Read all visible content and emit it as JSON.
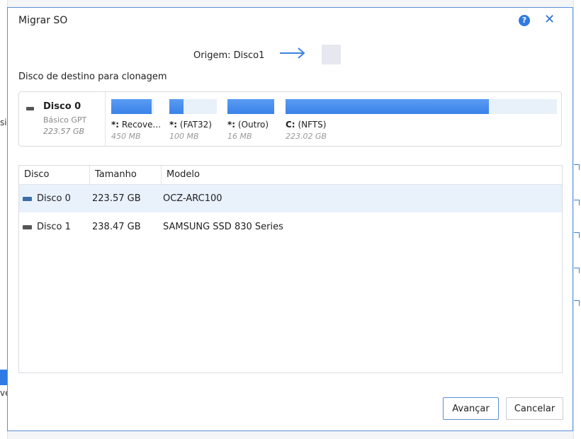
{
  "dialog": {
    "title": "Migrar SO",
    "help_icon": "question-circle-icon",
    "close_icon": "close-icon",
    "origin_label": "Origem: Disco1",
    "dest_label": "Disco de destino para clonagem",
    "accent_color": "#2f7be6"
  },
  "disk_map": {
    "name": "Disco 0",
    "type": "Básico GPT",
    "size": "223.57 GB",
    "partitions": [
      {
        "letter": "*:",
        "label": "Recove...",
        "size": "450 MB",
        "usage": 0.95
      },
      {
        "letter": "*:",
        "label": "(FAT32)",
        "size": "100 MB",
        "usage": 0.3
      },
      {
        "letter": "*:",
        "label": "(Outro)",
        "size": "16 MB",
        "usage": 1.0
      },
      {
        "letter": "C:",
        "label": "(NFTS)",
        "size": "223.02 GB",
        "usage": 0.75
      }
    ]
  },
  "table": {
    "columns": [
      "Disco",
      "Tamanho",
      "Modelo"
    ],
    "rows": [
      {
        "disk": "Disco 0",
        "size": "223.57 GB",
        "model": "OCZ-ARC100",
        "selected": true
      },
      {
        "disk": "Disco 1",
        "size": "238.47 GB",
        "model": "SAMSUNG SSD 830 Series",
        "selected": false
      }
    ]
  },
  "buttons": {
    "next": "Avançar",
    "cancel": "Cancelar"
  },
  "background": {
    "left_fragment_1": "si",
    "left_fragment_2": "ve"
  }
}
